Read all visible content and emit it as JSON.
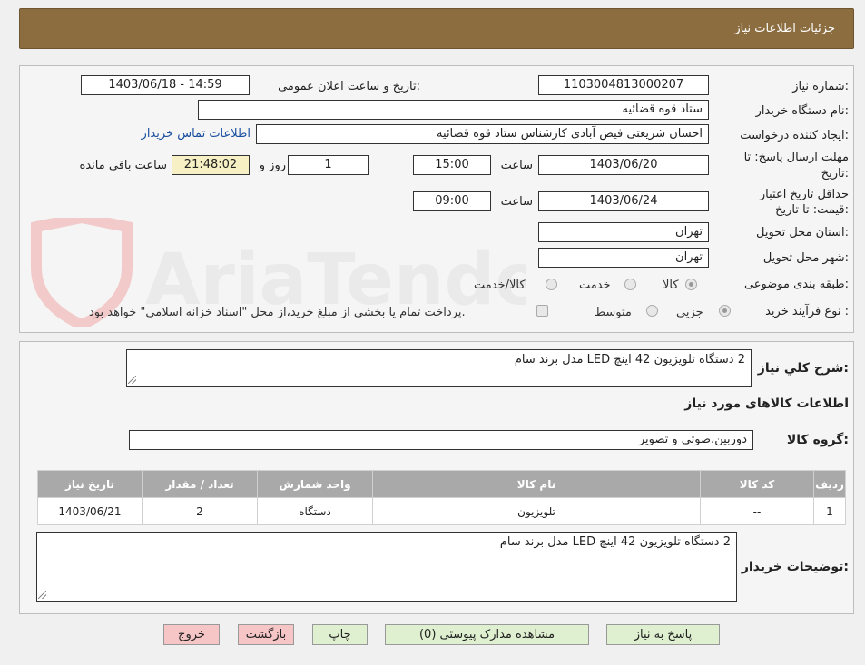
{
  "header": {
    "title": "جزئیات اطلاعات نیاز"
  },
  "form": {
    "need_number_label": "شماره نیاز:",
    "need_number": "1103004813000207",
    "announce_label": "تاریخ و ساعت اعلان عمومی:",
    "announce_value": "1403/06/18 - 14:59",
    "buyer_org_label": "نام دستگاه خریدار:",
    "buyer_org": "ستاد قوه قضائیه",
    "creator_label": "ایجاد کننده درخواست:",
    "creator": "احسان شریعتی فیض آبادی کارشناس ستاد قوه قضائیه",
    "contact_link": "اطلاعات تماس خریدار",
    "reply_deadline_label_1": "مهلت ارسال پاسخ: تا",
    "reply_deadline_label_2": "تاریخ:",
    "reply_date": "1403/06/20",
    "time_label": "ساعت",
    "reply_time": "15:00",
    "days": "1",
    "days_label": "روز و",
    "remaining": "21:48:02",
    "remaining_label": "ساعت باقی مانده",
    "validity_label_1": "حداقل تاریخ اعتبار",
    "validity_label_2": "قیمت: تا تاریخ:",
    "validity_date": "1403/06/24",
    "validity_time": "09:00",
    "province_label": "استان محل تحویل:",
    "province": "تهران",
    "city_label": "شهر محل تحویل:",
    "city": "تهران",
    "category_label": "طبقه بندی موضوعی:",
    "category_options": [
      "کالا",
      "خدمت",
      "کالا/خدمت"
    ],
    "process_label": "نوع فرآیند خرید :",
    "process_options": [
      "جزیی",
      "متوسط"
    ],
    "payment_note": "پرداخت تمام یا بخشی از مبلغ خرید،از محل \"اسناد خزانه اسلامی\" خواهد بود."
  },
  "details": {
    "summary_label": "شرح کلي نياز:",
    "summary": "2 دستگاه تلویزیون 42 اینچ LED مدل برند سام",
    "goods_info_title": "اطلاعات کالاهای مورد نیاز",
    "goods_group_label": "گروه کالا:",
    "goods_group": "دوربین،صوتی و تصویر",
    "table": {
      "headers": [
        "ردیف",
        "کد کالا",
        "نام کالا",
        "واحد شمارش",
        "تعداد / مقدار",
        "تاریخ نیاز"
      ],
      "rows": [
        [
          "1",
          "--",
          "تلویزیون",
          "دستگاه",
          "2",
          "1403/06/21"
        ]
      ]
    },
    "buyer_notes_label": "توضیحات خریدار:",
    "buyer_notes": "2 دستگاه تلویزیون 42 اینچ LED مدل برند سام"
  },
  "buttons": {
    "reply": "پاسخ به نیاز",
    "attachments": "مشاهده مدارک پیوستی (0)",
    "print": "چاپ",
    "back": "بازگشت",
    "exit": "خروج"
  },
  "watermark": {
    "text": "AriaTender.neT"
  }
}
